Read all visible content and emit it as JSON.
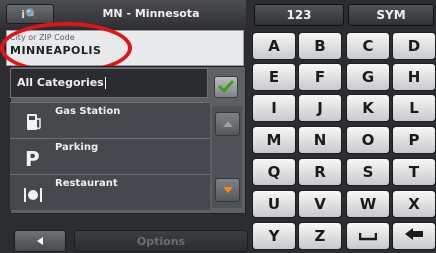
{
  "header": {
    "search_label": "i🔍",
    "title": "MN - Minnesota"
  },
  "city_field": {
    "label": "City or ZIP Code",
    "value": "MINNEAPOLIS"
  },
  "categories": {
    "filter_label": "All Categories",
    "items": [
      {
        "label": "Gas Station",
        "icon": "gas-pump-icon"
      },
      {
        "label": "Parking",
        "icon": "parking-icon"
      },
      {
        "label": "Restaurant",
        "icon": "restaurant-icon"
      }
    ]
  },
  "bottom": {
    "options_label": "Options"
  },
  "keyboard": {
    "tabs": [
      "123",
      "SYM"
    ],
    "rows": [
      [
        "A",
        "B",
        "C",
        "D"
      ],
      [
        "E",
        "F",
        "G",
        "H"
      ],
      [
        "I",
        "J",
        "K",
        "L"
      ],
      [
        "M",
        "N",
        "O",
        "P"
      ],
      [
        "Q",
        "R",
        "S",
        "T"
      ],
      [
        "U",
        "V",
        "W",
        "X"
      ],
      [
        "Y",
        "Z",
        "space",
        "backspace"
      ]
    ]
  },
  "colors": {
    "highlight_oval": "#e0141a",
    "ok_check": "#3aa21a",
    "scroll_down_arrow": "#f08a10"
  }
}
